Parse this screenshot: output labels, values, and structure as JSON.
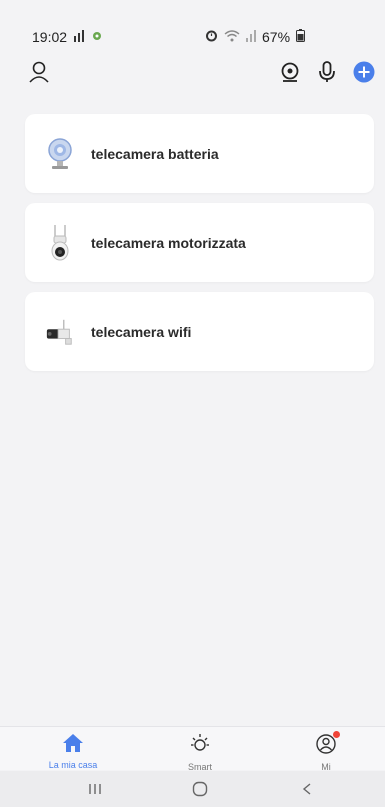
{
  "status_bar": {
    "time": "19:02",
    "battery_percent": "67%",
    "icons_left": [
      "signal-bars-icon",
      "android-debug-icon"
    ],
    "icons_right": [
      "alarm-icon",
      "wifi-icon",
      "cell-signal-icon",
      "battery-icon"
    ]
  },
  "top_bar": {
    "icons": [
      "user-icon",
      "camera-scan-icon",
      "microphone-icon",
      "add-icon"
    ],
    "accent_color": "#4a7fea"
  },
  "devices": [
    {
      "name": "telecamera batteria",
      "icon": "battery-camera-icon"
    },
    {
      "name": "telecamera motorizzata",
      "icon": "motorized-camera-icon"
    },
    {
      "name": "telecamera wifi",
      "icon": "wifi-camera-icon"
    }
  ],
  "tabs": [
    {
      "label": "La mia casa",
      "icon": "home-icon",
      "active": true
    },
    {
      "label": "Smart",
      "icon": "sun-icon",
      "active": false
    },
    {
      "label": "Mi",
      "icon": "profile-icon",
      "active": false,
      "notification_dot": true
    }
  ],
  "nav": [
    "recent-apps-icon",
    "home-circle-icon",
    "back-icon"
  ]
}
